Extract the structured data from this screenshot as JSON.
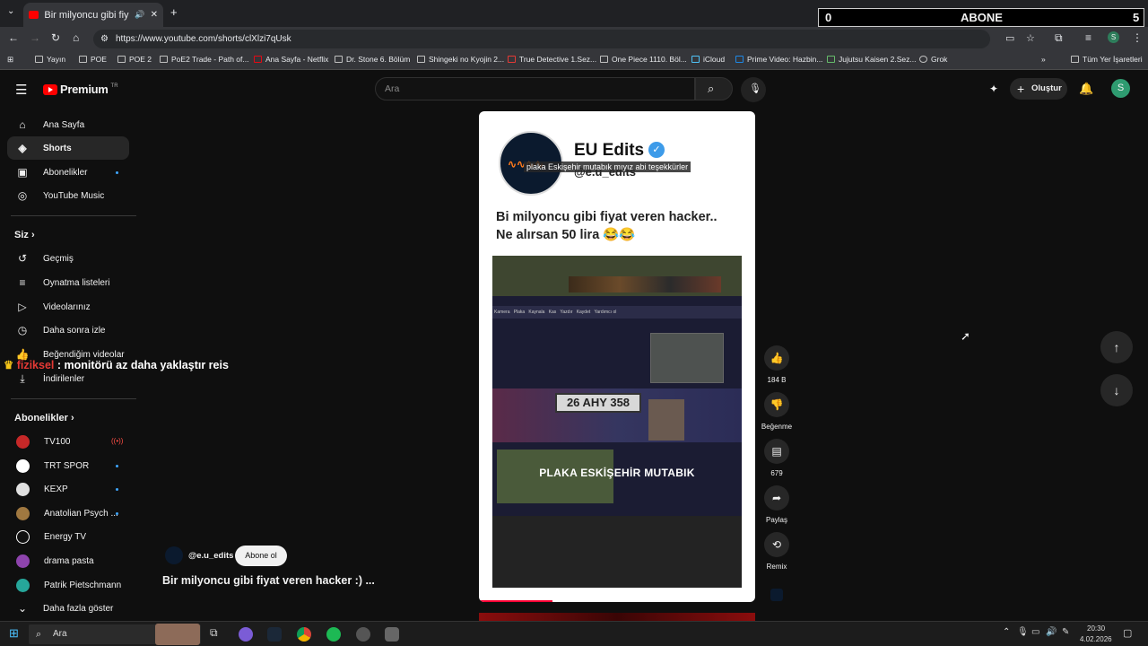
{
  "browser": {
    "tab_title": "Bir milyoncu gibi fiyat veren",
    "url": "https://www.youtube.com/shorts/clXlzi7qUsk",
    "bookmarks": [
      "Yayın",
      "POE",
      "POE 2",
      "PoE2 Trade - Path of...",
      "Ana Sayfa - Netflix",
      "Dr. Stone 6. Bölüm",
      "Shingeki no Kyojin 2...",
      "True Detective 1.Sez...",
      "One Piece 1110. Böl...",
      "iCloud",
      "Prime Video: Hazbin...",
      "Jujutsu Kaisen 2.Sez...",
      "Grok"
    ],
    "all_bookmarks": "Tüm Yer İşaretleri"
  },
  "overlay": {
    "left_count": "0",
    "label": "ABONE",
    "right_count": "5",
    "chat_user": "fiziksel",
    "chat_message": ": monitörü az daha yaklaştır reis"
  },
  "yt": {
    "logo": "Premium",
    "logo_badge": "TR",
    "search_placeholder": "Ara",
    "create_label": "Oluştur",
    "avatar_letter": "S",
    "nav": {
      "home": "Ana Sayfa",
      "shorts": "Shorts",
      "subs": "Abonelikler",
      "music": "YouTube Music",
      "you": "Siz",
      "history": "Geçmiş",
      "playlists": "Oynatma listeleri",
      "videos": "Videolarınız",
      "watch_later": "Daha sonra izle",
      "liked": "Beğendiğim videolar",
      "downloads": "İndirilenler",
      "subs_title": "Abonelikler",
      "channels": [
        "TV100",
        "TRT SPOR",
        "KEXP",
        "Anatolian Psych ...",
        "Energy TV",
        "drama pasta",
        "Patrik Pietschmann"
      ],
      "show_more": "Daha fazla göster"
    },
    "short": {
      "channel_name": "EU Edits",
      "handle": "@e.u_edits",
      "caption_overlay": "plaka Eskişehir mutabık mıyız abi teşekkürler",
      "post_text_1": "Bi milyoncu gibi fiyat veren hacker..",
      "post_text_2": "Ne alırsan 50 lira 😂😂",
      "plate": "26 AHY 358",
      "subtitle": "PLAKA ESKİŞEHİR MUTABIK",
      "menu": [
        "Kamera",
        "Plaka",
        "Kaynala",
        "Kas",
        "Yazdır",
        "Kaydet",
        "Yardımcı ol"
      ],
      "owner_handle": "@e.u_edits",
      "subscribe": "Abone ol",
      "title": "Bir milyoncu gibi fiyat veren hacker :) ...",
      "likes": "184 B",
      "dislike": "Beğenme",
      "comments": "679",
      "share": "Paylaş",
      "remix": "Remix"
    }
  },
  "taskbar": {
    "search": "Ara",
    "time": "20:30",
    "date": "4.02.2026"
  }
}
